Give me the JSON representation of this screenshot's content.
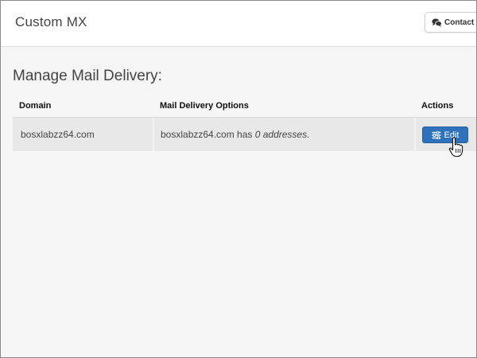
{
  "header": {
    "title": "Custom MX",
    "contact_button": "Contact S"
  },
  "section": {
    "title": "Manage Mail Delivery:"
  },
  "table": {
    "columns": [
      "Domain",
      "Mail Delivery Options",
      "Actions"
    ],
    "rows": [
      {
        "domain": "bosxlabzz64.com",
        "options_prefix": "bosxlabzz64.com has ",
        "options_emphasis": "0 addresses.",
        "action_label": "Edit"
      }
    ]
  },
  "colors": {
    "primary_button": "#2f72bb",
    "row_background": "#e8e8e8",
    "page_background": "#f5f5f5"
  }
}
